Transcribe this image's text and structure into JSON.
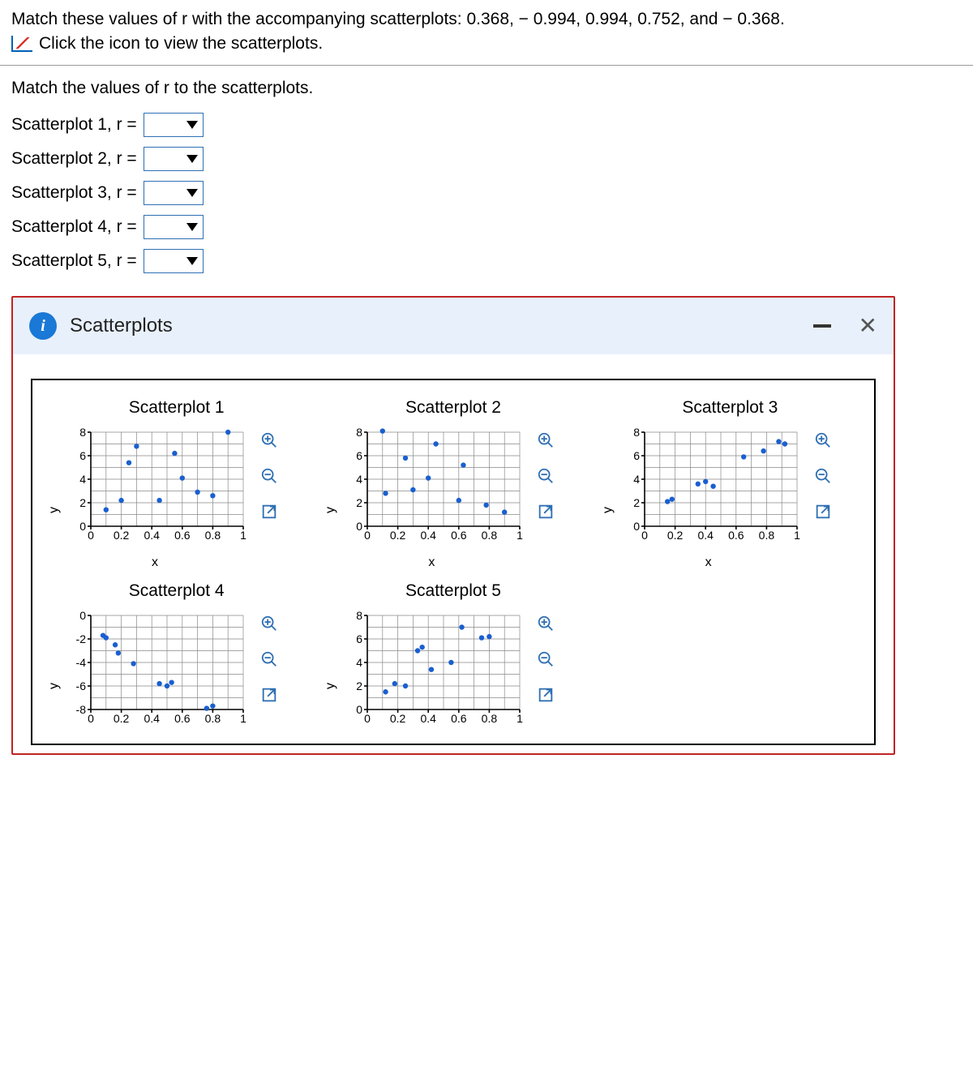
{
  "prompt": "Match these values of r with the accompanying scatterplots: 0.368,  − 0.994, 0.994, 0.752, and  − 0.368.",
  "link_text": "Click the icon to view the scatterplots.",
  "subprompt": "Match the values of r to the scatterplots.",
  "match_labels": [
    "Scatterplot 1, r =",
    "Scatterplot 2, r =",
    "Scatterplot 3, r =",
    "Scatterplot 4, r =",
    "Scatterplot 5, r ="
  ],
  "modal_title": "Scatterplots",
  "plots": {
    "titles": [
      "Scatterplot 1",
      "Scatterplot 2",
      "Scatterplot 3",
      "Scatterplot 4",
      "Scatterplot 5"
    ],
    "xlabel": "x",
    "ylabel": "y"
  },
  "chart_data": [
    {
      "type": "scatter",
      "title": "Scatterplot 1",
      "xlabel": "x",
      "ylabel": "y",
      "xlim": [
        0,
        1
      ],
      "ylim": [
        0,
        8
      ],
      "xticks": [
        0,
        0.2,
        0.4,
        0.6,
        0.8,
        1
      ],
      "yticks": [
        0,
        2,
        4,
        6,
        8
      ],
      "points": [
        [
          0.1,
          1.4
        ],
        [
          0.2,
          2.2
        ],
        [
          0.25,
          5.4
        ],
        [
          0.3,
          6.8
        ],
        [
          0.45,
          2.2
        ],
        [
          0.55,
          6.2
        ],
        [
          0.6,
          4.1
        ],
        [
          0.7,
          2.9
        ],
        [
          0.8,
          2.6
        ],
        [
          0.9,
          8.0
        ]
      ],
      "r_estimate": 0.368
    },
    {
      "type": "scatter",
      "title": "Scatterplot 2",
      "xlabel": "x",
      "ylabel": "y",
      "xlim": [
        0,
        1
      ],
      "ylim": [
        0,
        8
      ],
      "xticks": [
        0,
        0.2,
        0.4,
        0.6,
        0.8,
        1
      ],
      "yticks": [
        0,
        2,
        4,
        6,
        8
      ],
      "points": [
        [
          0.1,
          8.1
        ],
        [
          0.12,
          2.8
        ],
        [
          0.25,
          5.8
        ],
        [
          0.3,
          3.1
        ],
        [
          0.4,
          4.1
        ],
        [
          0.45,
          7.0
        ],
        [
          0.6,
          2.2
        ],
        [
          0.63,
          5.2
        ],
        [
          0.78,
          1.8
        ],
        [
          0.9,
          1.2
        ]
      ],
      "r_estimate": -0.368
    },
    {
      "type": "scatter",
      "title": "Scatterplot 3",
      "xlabel": "x",
      "ylabel": "y",
      "xlim": [
        0,
        1
      ],
      "ylim": [
        0,
        8
      ],
      "xticks": [
        0,
        0.2,
        0.4,
        0.6,
        0.8,
        1
      ],
      "yticks": [
        0,
        2,
        4,
        6,
        8
      ],
      "points": [
        [
          0.15,
          2.1
        ],
        [
          0.18,
          2.3
        ],
        [
          0.35,
          3.6
        ],
        [
          0.4,
          3.8
        ],
        [
          0.45,
          3.4
        ],
        [
          0.65,
          5.9
        ],
        [
          0.78,
          6.4
        ],
        [
          0.88,
          7.2
        ],
        [
          0.92,
          7.0
        ]
      ],
      "r_estimate": 0.994
    },
    {
      "type": "scatter",
      "title": "Scatterplot 4",
      "xlabel": "x",
      "ylabel": "y",
      "xlim": [
        0,
        1
      ],
      "ylim": [
        -8,
        0
      ],
      "xticks": [
        0,
        0.2,
        0.4,
        0.6,
        0.8,
        1
      ],
      "yticks": [
        -8,
        -6,
        -4,
        -2,
        0
      ],
      "points": [
        [
          0.08,
          -1.7
        ],
        [
          0.1,
          -1.9
        ],
        [
          0.16,
          -2.5
        ],
        [
          0.18,
          -3.2
        ],
        [
          0.28,
          -4.1
        ],
        [
          0.45,
          -5.8
        ],
        [
          0.5,
          -6.0
        ],
        [
          0.53,
          -5.7
        ],
        [
          0.76,
          -7.9
        ],
        [
          0.8,
          -7.7
        ]
      ],
      "r_estimate": -0.994
    },
    {
      "type": "scatter",
      "title": "Scatterplot 5",
      "xlabel": "x",
      "ylabel": "y",
      "xlim": [
        0,
        1
      ],
      "ylim": [
        0,
        8
      ],
      "xticks": [
        0,
        0.2,
        0.4,
        0.6,
        0.8,
        1
      ],
      "yticks": [
        0,
        2,
        4,
        6,
        8
      ],
      "points": [
        [
          0.12,
          1.5
        ],
        [
          0.18,
          2.2
        ],
        [
          0.25,
          2.0
        ],
        [
          0.33,
          5.0
        ],
        [
          0.36,
          5.3
        ],
        [
          0.42,
          3.4
        ],
        [
          0.55,
          4.0
        ],
        [
          0.62,
          7.0
        ],
        [
          0.75,
          6.1
        ],
        [
          0.8,
          6.2
        ]
      ],
      "r_estimate": 0.752
    }
  ]
}
